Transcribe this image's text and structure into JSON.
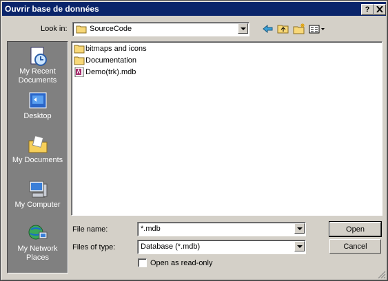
{
  "window": {
    "title": "Ouvrir base de données",
    "help_btn": "?",
    "close_btn": "X"
  },
  "lookin": {
    "label": "Look in:",
    "value": "SourceCode"
  },
  "places": [
    {
      "label_l1": "My Recent",
      "label_l2": "Documents",
      "icon": "recent-documents-icon"
    },
    {
      "label_l1": "Desktop",
      "label_l2": "",
      "icon": "desktop-icon"
    },
    {
      "label_l1": "My Documents",
      "label_l2": "",
      "icon": "my-documents-icon"
    },
    {
      "label_l1": "My Computer",
      "label_l2": "",
      "icon": "my-computer-icon"
    },
    {
      "label_l1": "My Network",
      "label_l2": "Places",
      "icon": "network-places-icon"
    }
  ],
  "files": [
    {
      "name": "bitmaps and icons",
      "icon": "folder-icon"
    },
    {
      "name": "Documentation",
      "icon": "folder-icon"
    },
    {
      "name": "Demo(trk).mdb",
      "icon": "access-db-icon"
    }
  ],
  "filename": {
    "label": "File name:",
    "value": "*.mdb"
  },
  "filetype": {
    "label": "Files of type:",
    "value": "Database (*.mdb)"
  },
  "readonly": {
    "label": "Open as read-only",
    "checked": false
  },
  "buttons": {
    "open": "Open",
    "cancel": "Cancel"
  },
  "colors": {
    "titlebar": "#0a246a",
    "face": "#d4d0c8",
    "places_bg": "#808080"
  }
}
